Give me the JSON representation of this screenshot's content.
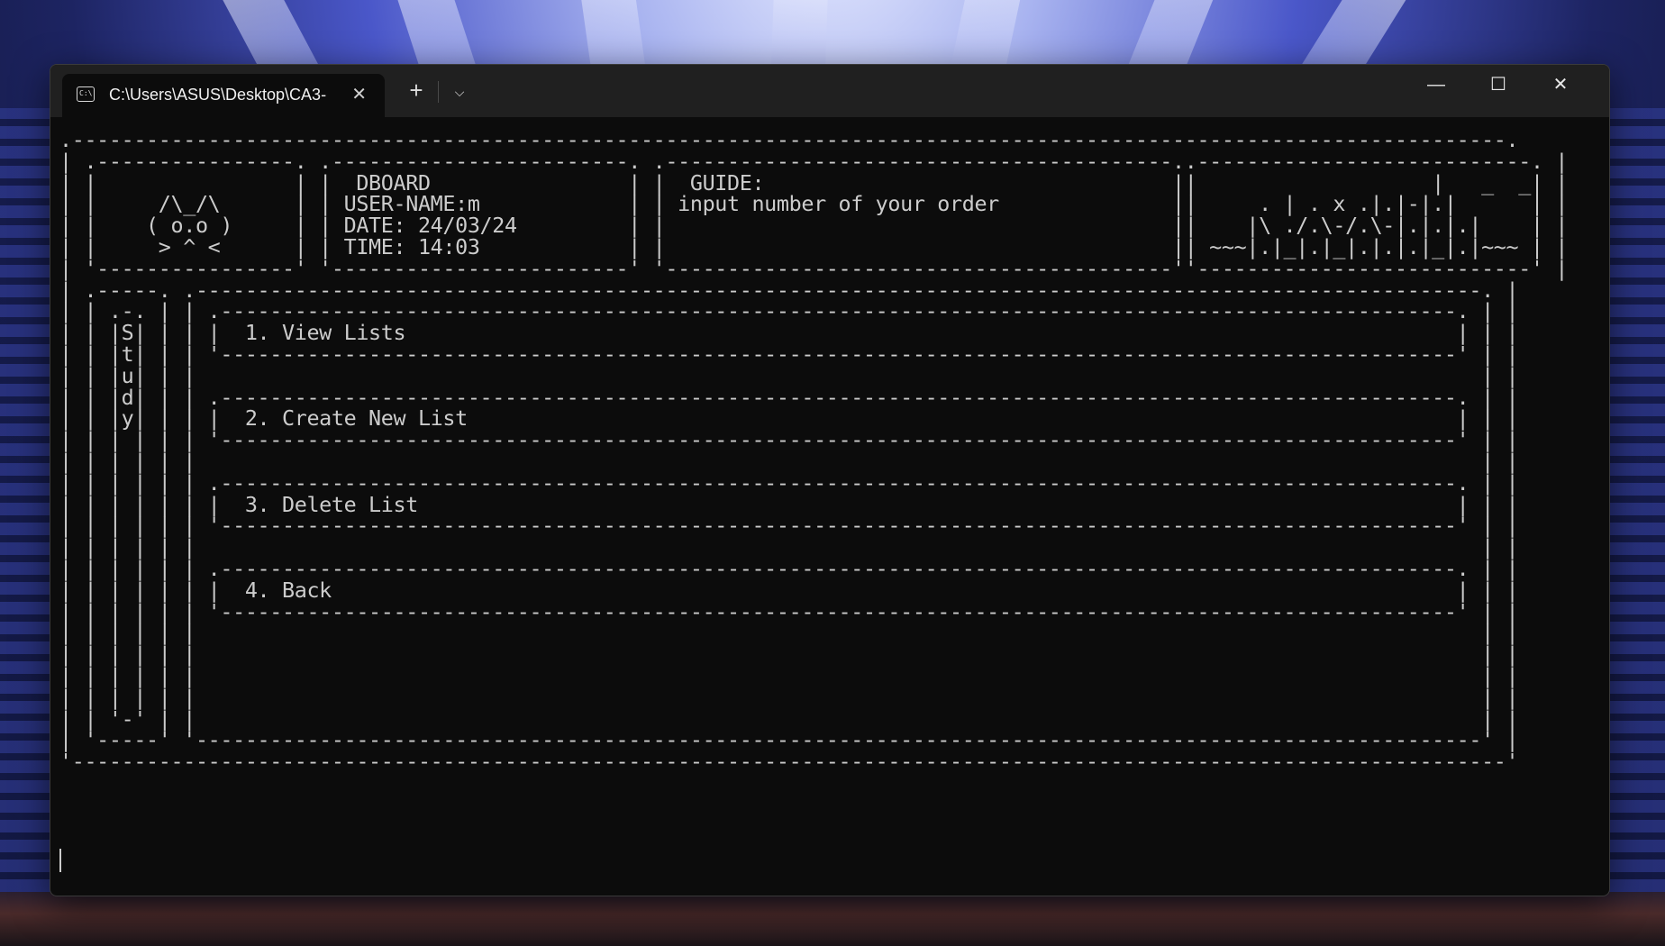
{
  "window": {
    "tab_title": "C:\\Users\\ASUS\\Desktop\\CA3-",
    "tab_icon": "C:\\",
    "new_tab_label": "+",
    "dropdown_label": "⌵",
    "minimize_label": "—",
    "maximize_label": "☐",
    "close_label": "✕",
    "tab_close_label": "✕"
  },
  "header": {
    "cat_line1": "/\\_/\\",
    "cat_line2": "( o.o )",
    "cat_line3": "> ^ <",
    "board_title": "DBOARD",
    "username": "USER-NAME:m",
    "date": "DATE: 24/03/24",
    "time": "TIME: 14:03",
    "guide_title": "GUIDE:",
    "guide_text": "input number of your order",
    "art_line1": "|   _  _",
    "art_line2": ". | . x .|.|-|.|",
    "art_line3": "|\\ ./.\\-/.\\-|.|.|.|",
    "art_line4": "~~~|.|_|.|_|.|.|.|_|.|~~~"
  },
  "sidebar_label": [
    "S",
    "t",
    "u",
    "d",
    "y"
  ],
  "menu": [
    "1. View Lists",
    "2. Create New List",
    "3. Delete List",
    "4. Back"
  ],
  "colors": {
    "terminal_bg": "#0c0c0c",
    "terminal_fg": "#cccccc",
    "titlebar_bg": "#202020"
  }
}
